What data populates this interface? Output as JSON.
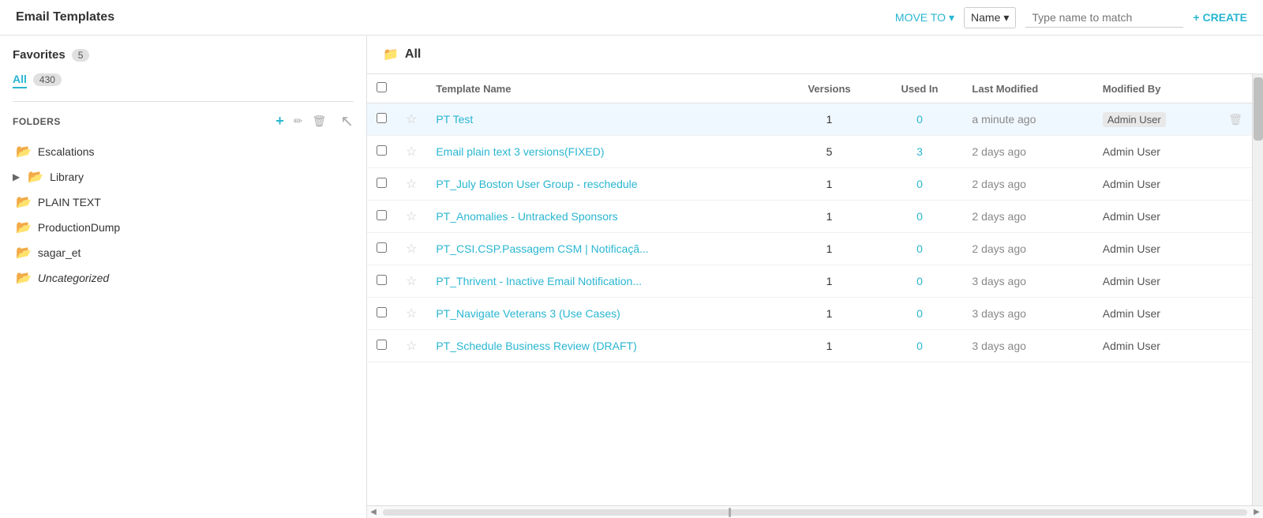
{
  "header": {
    "title": "Email Templates",
    "move_to_label": "MOVE TO",
    "filter_label": "Name",
    "search_placeholder": "Type name to match",
    "create_label": "+ CREATE"
  },
  "sidebar": {
    "favorites_label": "Favorites",
    "favorites_count": "5",
    "all_label": "All",
    "all_count": "430",
    "folders_label": "FOLDERS",
    "folders": [
      {
        "name": "Escalations",
        "has_arrow": false,
        "italic": false
      },
      {
        "name": "Library",
        "has_arrow": true,
        "italic": false
      },
      {
        "name": "PLAIN TEXT",
        "has_arrow": false,
        "italic": false
      },
      {
        "name": "ProductionDump",
        "has_arrow": false,
        "italic": false
      },
      {
        "name": "sagar_et",
        "has_arrow": false,
        "italic": false
      },
      {
        "name": "Uncategorized",
        "has_arrow": false,
        "italic": true
      }
    ]
  },
  "content": {
    "folder_label": "All",
    "columns": {
      "template_name": "Template Name",
      "versions": "Versions",
      "used_in": "Used In",
      "last_modified": "Last Modified",
      "modified_by": "Modified By"
    },
    "rows": [
      {
        "name": "PT Test",
        "versions": "1",
        "used_in": "0",
        "used_in_link": false,
        "last_modified": "a minute ago",
        "modified_by": "Admin User",
        "highlighted": true
      },
      {
        "name": "Email plain text 3 versions(FIXED)",
        "versions": "5",
        "used_in": "3",
        "used_in_link": true,
        "last_modified": "2 days ago",
        "modified_by": "Admin User",
        "highlighted": false
      },
      {
        "name": "PT_July Boston User Group - reschedule",
        "versions": "1",
        "used_in": "0",
        "used_in_link": false,
        "last_modified": "2 days ago",
        "modified_by": "Admin User",
        "highlighted": false
      },
      {
        "name": "PT_Anomalies - Untracked Sponsors",
        "versions": "1",
        "used_in": "0",
        "used_in_link": false,
        "last_modified": "2 days ago",
        "modified_by": "Admin User",
        "highlighted": false
      },
      {
        "name": "PT_CSI.CSP.Passagem CSM | Notificaçã...",
        "versions": "1",
        "used_in": "0",
        "used_in_link": false,
        "last_modified": "2 days ago",
        "modified_by": "Admin User",
        "highlighted": false
      },
      {
        "name": "PT_Thrivent - Inactive Email Notification...",
        "versions": "1",
        "used_in": "0",
        "used_in_link": false,
        "last_modified": "3 days ago",
        "modified_by": "Admin User",
        "highlighted": false
      },
      {
        "name": "PT_Navigate Veterans 3 (Use Cases)",
        "versions": "1",
        "used_in": "0",
        "used_in_link": false,
        "last_modified": "3 days ago",
        "modified_by": "Admin User",
        "highlighted": false
      },
      {
        "name": "PT_Schedule Business Review (DRAFT)",
        "versions": "1",
        "used_in": "0",
        "used_in_link": false,
        "last_modified": "3 days ago",
        "modified_by": "Admin User",
        "highlighted": false
      }
    ]
  },
  "icons": {
    "chevron_down": "▾",
    "plus": "+",
    "edit": "✏",
    "delete": "🗑",
    "folder": "📁",
    "star_empty": "☆",
    "arrow_right": "▶",
    "scroll_up": "▲",
    "scroll_down": "▼",
    "scroll_left": "◀",
    "scroll_right": "▶",
    "trash": "🗑"
  },
  "colors": {
    "accent": "#29b6d1",
    "highlight_row": "#f0f8ff"
  }
}
